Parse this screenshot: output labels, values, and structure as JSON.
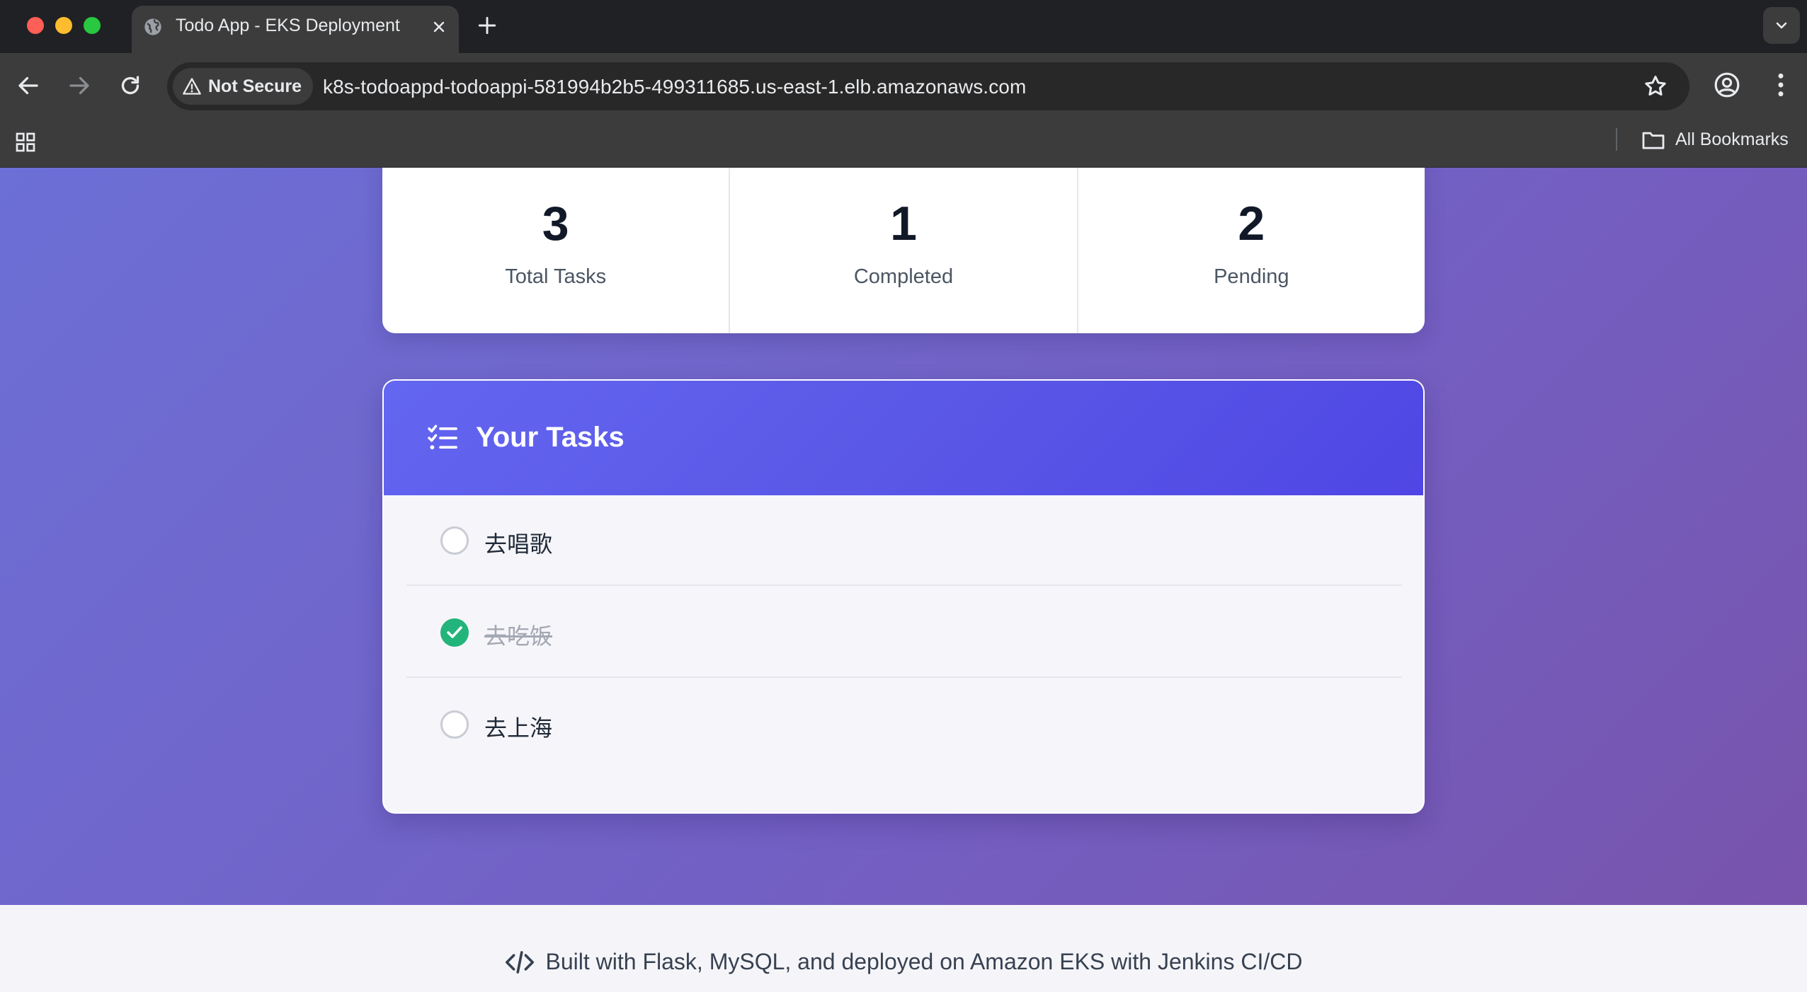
{
  "browser": {
    "tab_title": "Todo App - EKS Deployment",
    "security_label": "Not Secure",
    "url": "k8s-todoappd-todoappi-581994b2b5-499311685.us-east-1.elb.amazonaws.com",
    "bookmarks_label": "All Bookmarks"
  },
  "stats": [
    {
      "value": "3",
      "label": "Total Tasks"
    },
    {
      "value": "1",
      "label": "Completed"
    },
    {
      "value": "2",
      "label": "Pending"
    }
  ],
  "tasks_panel": {
    "title": "Your Tasks",
    "items": [
      {
        "text": "去唱歌",
        "completed": false
      },
      {
        "text": "去吃饭",
        "completed": true
      },
      {
        "text": "去上海",
        "completed": false
      }
    ]
  },
  "footer": {
    "text": "Built with Flask, MySQL, and deployed on Amazon EKS with Jenkins CI/CD"
  },
  "colors": {
    "accent": "#6366f1",
    "completed_green": "#22b47a",
    "page_gradient_start": "#6c6fd6",
    "page_gradient_end": "#7853ab"
  },
  "icons": {
    "tab_favicon": "globe-icon",
    "tasks_header": "list-check-icon",
    "footer": "code-icon"
  }
}
